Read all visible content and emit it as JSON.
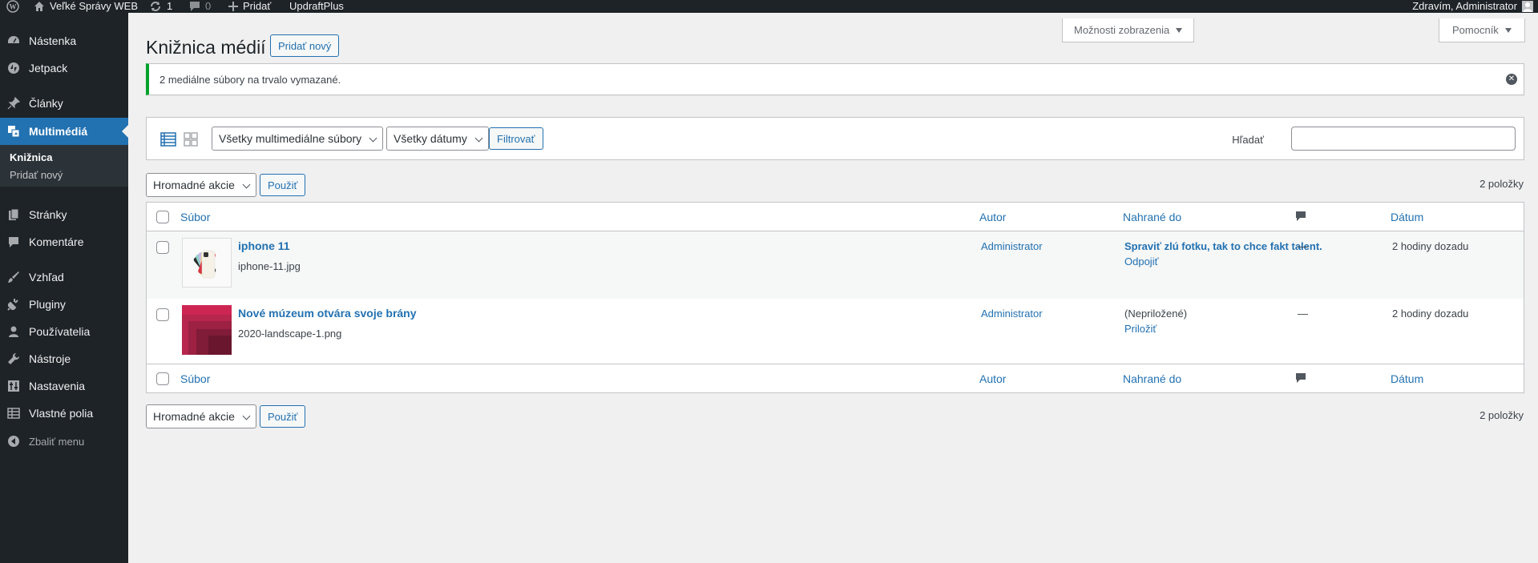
{
  "adminbar": {
    "site_name": "Veľké Správy WEB",
    "updates_count": "1",
    "comments_count": "0",
    "new_label": "Pridať",
    "plugin_label": "UpdraftPlus",
    "greeting": "Zdravím, Administrator"
  },
  "sidebar": {
    "items": [
      {
        "label": "Nástenka",
        "icon": "dashboard-icon"
      },
      {
        "label": "Jetpack",
        "icon": "jetpack-icon"
      },
      {
        "label": "Články",
        "icon": "pin-icon"
      },
      {
        "label": "Multimédiá",
        "icon": "media-icon"
      },
      {
        "label": "Stránky",
        "icon": "pages-icon"
      },
      {
        "label": "Komentáre",
        "icon": "comment-icon"
      },
      {
        "label": "Vzhľad",
        "icon": "brush-icon"
      },
      {
        "label": "Pluginy",
        "icon": "plugin-icon"
      },
      {
        "label": "Používatelia",
        "icon": "user-icon"
      },
      {
        "label": "Nástroje",
        "icon": "wrench-icon"
      },
      {
        "label": "Nastavenia",
        "icon": "settings-icon"
      },
      {
        "label": "Vlastné polia",
        "icon": "table-icon"
      }
    ],
    "submenu": [
      "Knižnica",
      "Pridať nový"
    ],
    "collapse_label": "Zbaliť menu"
  },
  "header": {
    "title": "Knižnica médií",
    "add_new": "Pridať nový",
    "screen_options": "Možnosti zobrazenia",
    "help": "Pomocník"
  },
  "notice": {
    "text": "2 mediálne súbory na trvalo vymazané."
  },
  "filters": {
    "media_type": "Všetky multimediálne súbory",
    "dates": "Všetky dátumy",
    "filter_button": "Filtrovať",
    "search_label": "Hľadať",
    "search_value": ""
  },
  "bulk": {
    "action": "Hromadné akcie",
    "apply": "Použiť",
    "count": "2 položky"
  },
  "table": {
    "columns": {
      "file": "Súbor",
      "author": "Autor",
      "uploaded_to": "Nahrané do",
      "date": "Dátum"
    },
    "rows": [
      {
        "title": "iphone 11",
        "filename": "iphone-11.jpg",
        "author": "Administrator",
        "uploaded_to": "Spraviť zlú fotku, tak to chce fakt talent.",
        "attach_action": "Odpojiť",
        "comments": "—",
        "date": "2 hodiny dozadu"
      },
      {
        "title": "Nové múzeum otvára svoje brány",
        "filename": "2020-landscape-1.png",
        "author": "Administrator",
        "uploaded_to": "(Nepriložené)",
        "attach_action": "Priložiť",
        "comments": "—",
        "date": "2 hodiny dozadu"
      }
    ]
  },
  "colors": {
    "accent": "#2271b1",
    "sidebar_bg": "#1d2327",
    "notice_success": "#00a32a"
  }
}
